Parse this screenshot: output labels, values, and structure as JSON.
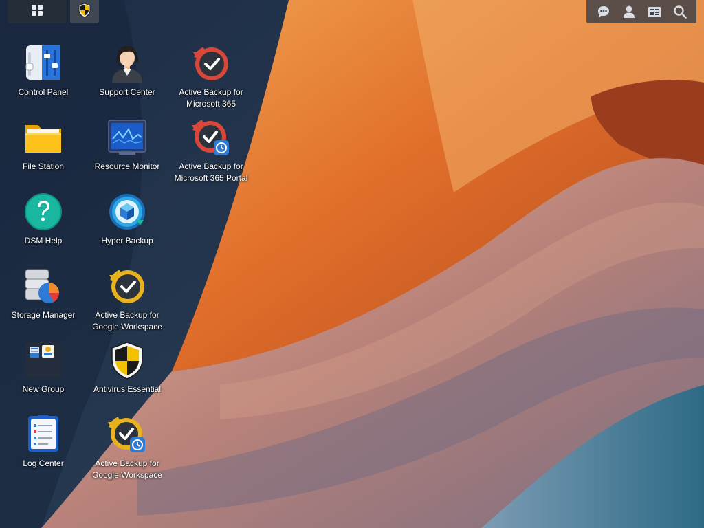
{
  "taskbar": {
    "main_menu_icon": "grid-icon",
    "pinned_app_icon": "antivirus-icon",
    "tray": [
      {
        "name": "chat-icon"
      },
      {
        "name": "user-icon"
      },
      {
        "name": "widgets-icon"
      },
      {
        "name": "search-icon"
      }
    ]
  },
  "desktop": {
    "control_panel": "Control Panel",
    "support_center": "Support Center",
    "ab365": "Active Backup for Microsoft 365",
    "file_station": "File Station",
    "resource_monitor": "Resource Monitor",
    "ab365_portal": "Active Backup for Microsoft 365 Portal",
    "dsm_help": "DSM Help",
    "hyper_backup": "Hyper Backup",
    "storage_manager": "Storage Manager",
    "abgw": "Active Backup for Google Workspace",
    "new_group": "New Group",
    "antivirus": "Antivirus Essential",
    "log_center": "Log Center",
    "abgw_portal": "Active Backup for Google Workspace"
  },
  "colors": {
    "taskbar_bg": "#2a2f38",
    "accent_red": "#d9473b",
    "accent_gold": "#e8b21e",
    "accent_blue": "#2e7bd6"
  }
}
